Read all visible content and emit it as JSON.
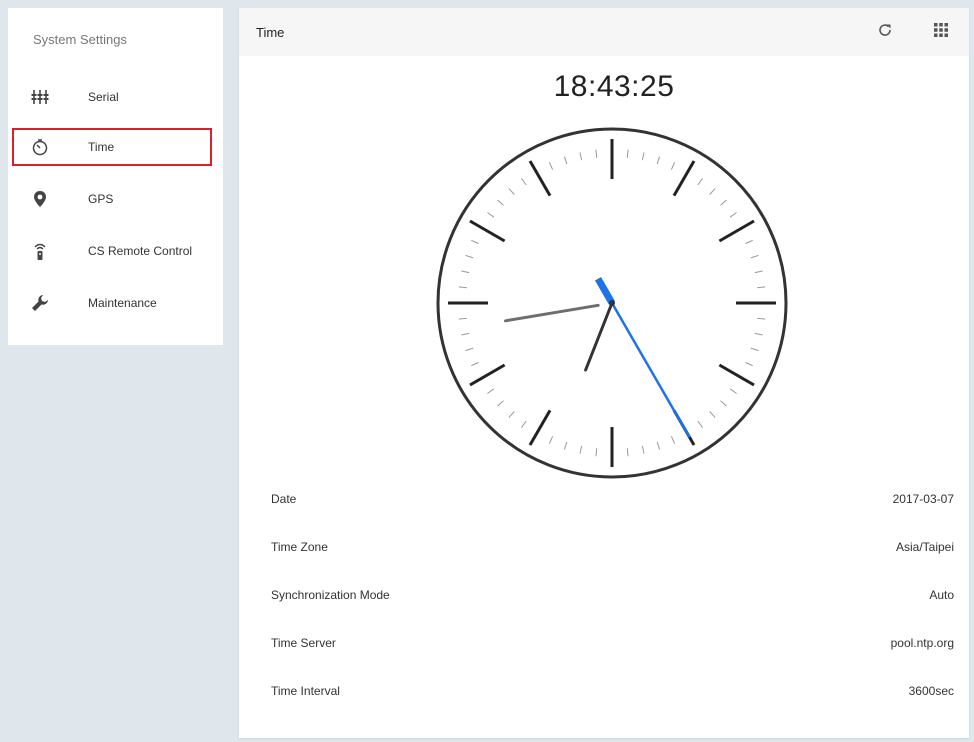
{
  "sidebar": {
    "title": "System Settings",
    "items": [
      {
        "label": "Serial",
        "icon": "serial-equalizer-icon"
      },
      {
        "label": "Time",
        "icon": "timer-icon",
        "selected": true
      },
      {
        "label": "GPS",
        "icon": "location-pin-icon"
      },
      {
        "label": "CS Remote Control",
        "icon": "remote-control-icon"
      },
      {
        "label": "Maintenance",
        "icon": "wrench-icon"
      }
    ]
  },
  "header": {
    "title": "Time",
    "refresh_icon": "refresh-icon",
    "apps_icon": "apps-grid-icon"
  },
  "clock": {
    "digital": "18:43:25",
    "hour": 18,
    "minute": 43,
    "second": 25
  },
  "details": [
    {
      "key": "Date",
      "value": "2017-03-07"
    },
    {
      "key": "Time Zone",
      "value": "Asia/Taipei"
    },
    {
      "key": "Synchronization Mode",
      "value": "Auto"
    },
    {
      "key": "Time Server",
      "value": "pool.ntp.org"
    },
    {
      "key": "Time Interval",
      "value": "3600sec"
    }
  ],
  "colors": {
    "accent_blue": "#1e73e8",
    "selected_outline": "#d9202e",
    "background": "#dfe6ec"
  }
}
